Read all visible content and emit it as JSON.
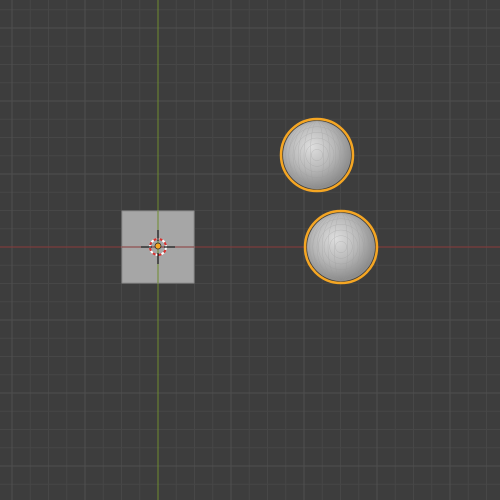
{
  "viewport": {
    "type": "3d-viewport-top-orthographic",
    "colors": {
      "background": "#3d3d3d",
      "grid_minor": "#474747",
      "grid_major": "#4f4f4f",
      "x_axis": "#8a3a3a",
      "y_axis": "#6e8c2f",
      "selection_outline": "#f5a623",
      "cube_face": "#a6a6a6",
      "sphere_light": "#dddddd",
      "sphere_dark": "#8c8c8c"
    },
    "objects": [
      {
        "name": "cube",
        "kind": "mesh-cube",
        "selected": false
      },
      {
        "name": "sphere-1",
        "kind": "mesh-uv-sphere",
        "selected": true
      },
      {
        "name": "sphere-2",
        "kind": "mesh-uv-sphere",
        "selected": true
      }
    ],
    "cursor": {
      "name": "3d-cursor",
      "icon": "crosshair-icon"
    }
  }
}
